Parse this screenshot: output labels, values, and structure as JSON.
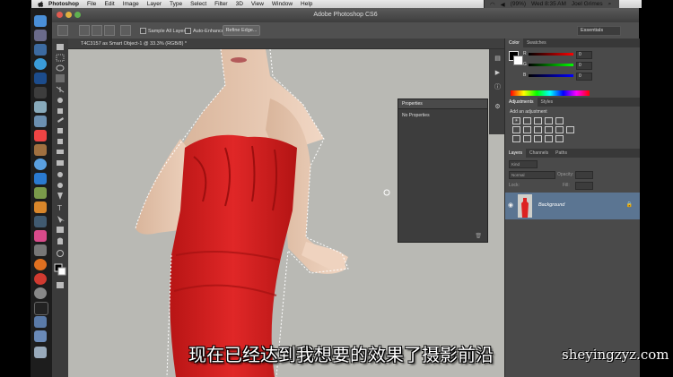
{
  "menubar": {
    "items": [
      "Photoshop",
      "File",
      "Edit",
      "Image",
      "Layer",
      "Type",
      "Select",
      "Filter",
      "3D",
      "View",
      "Window",
      "Help"
    ],
    "battery": "(99%)",
    "clock": "Wed 8:35 AM",
    "user": "Joel Grimes"
  },
  "window": {
    "title": "Adobe Photoshop CS6"
  },
  "options_bar": {
    "sample_all_layers": "Sample All Layers",
    "auto_enhance": "Auto-Enhance",
    "refine_edge": "Refine Edge...",
    "workspace": "Essentials"
  },
  "document": {
    "tab": "T4C3157 as Smart Object-1 @ 33.3% (RGB/8) *"
  },
  "properties_panel": {
    "title": "Properties",
    "content": "No Properties"
  },
  "color_panel": {
    "tabs": [
      "Color",
      "Swatches"
    ],
    "channels": [
      {
        "label": "R",
        "value": "0"
      },
      {
        "label": "G",
        "value": "0"
      },
      {
        "label": "B",
        "value": "0"
      }
    ]
  },
  "adjustments_panel": {
    "tabs": [
      "Adjustments",
      "Styles"
    ],
    "heading": "Add an adjustment"
  },
  "layers_panel": {
    "tabs": [
      "Layers",
      "Channels",
      "Paths"
    ],
    "kind": "Kind",
    "blend_mode": "Normal",
    "opacity_label": "Opacity:",
    "lock_label": "Lock:",
    "fill_label": "Fill:",
    "layers": [
      {
        "name": "Background"
      }
    ]
  },
  "subtitle": "现在已经达到我想要的效果了摄影前沿",
  "watermark": "sheyingzyz.com",
  "colors": {
    "accent": "#5b7592",
    "dress": "#d62222",
    "canvas": "#b9b9b4"
  }
}
